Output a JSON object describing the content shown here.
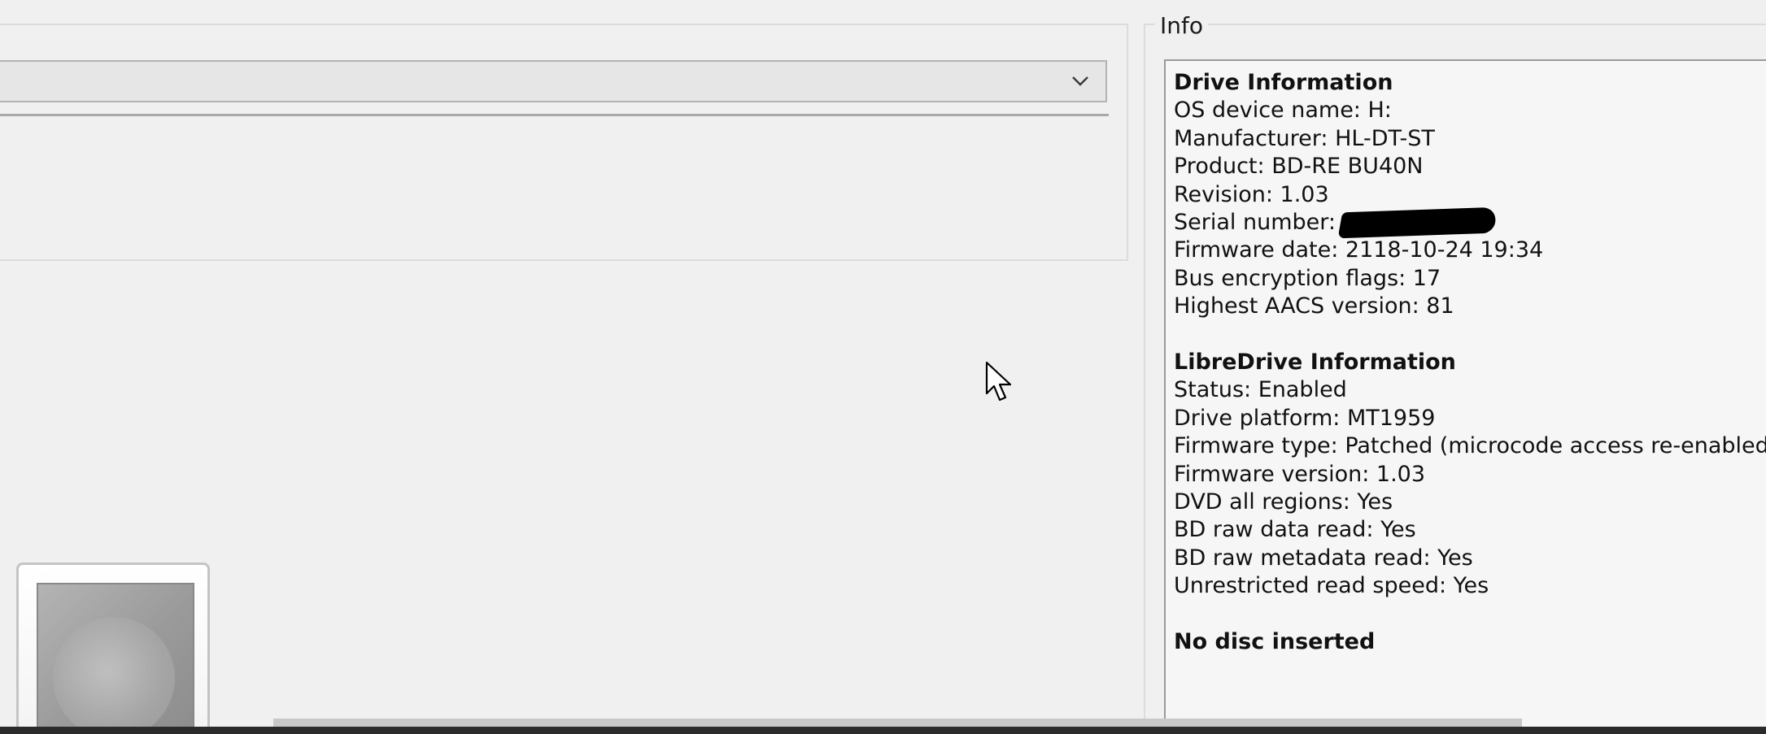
{
  "drive_selector": {
    "value": ""
  },
  "info": {
    "legend": "Info",
    "drive_info": {
      "heading": "Drive Information",
      "lines": [
        "OS device name: H:",
        "Manufacturer: HL-DT-ST",
        "Product: BD-RE BU40N",
        "Revision: 1.03"
      ],
      "serial_label": "Serial number:",
      "lines_after": [
        "Firmware date: 2118-10-24 19:34",
        "Bus encryption flags: 17",
        "Highest AACS version: 81"
      ]
    },
    "libredrive": {
      "heading": "LibreDrive Information",
      "lines": [
        "Status: Enabled",
        "Drive platform: MT1959",
        "Firmware type: Patched (microcode access re-enabled)",
        "Firmware version: 1.03",
        "DVD all regions: Yes",
        "BD raw data read: Yes",
        "BD raw metadata read: Yes",
        "Unrestricted read speed: Yes"
      ]
    },
    "disc_status": "No disc inserted"
  },
  "icons": {
    "dropdown": "chevron-down-icon",
    "drive": "optical-drive-icon",
    "cursor": "mouse-pointer-icon"
  }
}
